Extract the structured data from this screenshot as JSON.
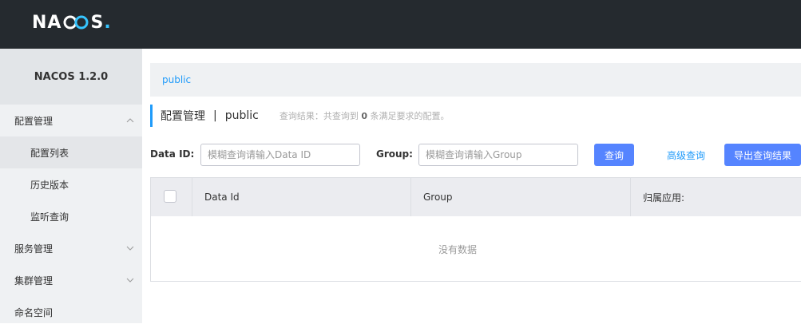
{
  "brand": {
    "logo_n": "N",
    "logo_a": "A",
    "logo_s": "S",
    "logo_dot": ".",
    "accent": "#36c5ff"
  },
  "sidebar": {
    "version": "NACOS 1.2.0",
    "groups": [
      {
        "label": "配置管理",
        "chevron": "up",
        "items": [
          "配置列表",
          "历史版本",
          "监听查询"
        ]
      },
      {
        "label": "服务管理",
        "chevron": "down"
      },
      {
        "label": "集群管理",
        "chevron": "down"
      },
      {
        "label": "命名空间"
      }
    ]
  },
  "breadcrumb": {
    "namespace": "public"
  },
  "page": {
    "title": "配置管理",
    "separator": "|",
    "namespace": "public",
    "result_prefix": "查询结果：共查询到",
    "result_count": "0",
    "result_suffix": "条满足要求的配置。"
  },
  "filters": {
    "data_id_label": "Data ID:",
    "data_id_placeholder": "模糊查询请输入Data ID",
    "group_label": "Group:",
    "group_placeholder": "模糊查询请输入Group",
    "search_button": "查询",
    "advanced_link": "高级查询",
    "export_button": "导出查询结果"
  },
  "table": {
    "columns": [
      "Data Id",
      "Group",
      "归属应用:"
    ],
    "empty_text": "没有数据"
  },
  "colors": {
    "topbar": "#252a2f",
    "primary_button": "#5584ff",
    "link": "#209bfa"
  }
}
